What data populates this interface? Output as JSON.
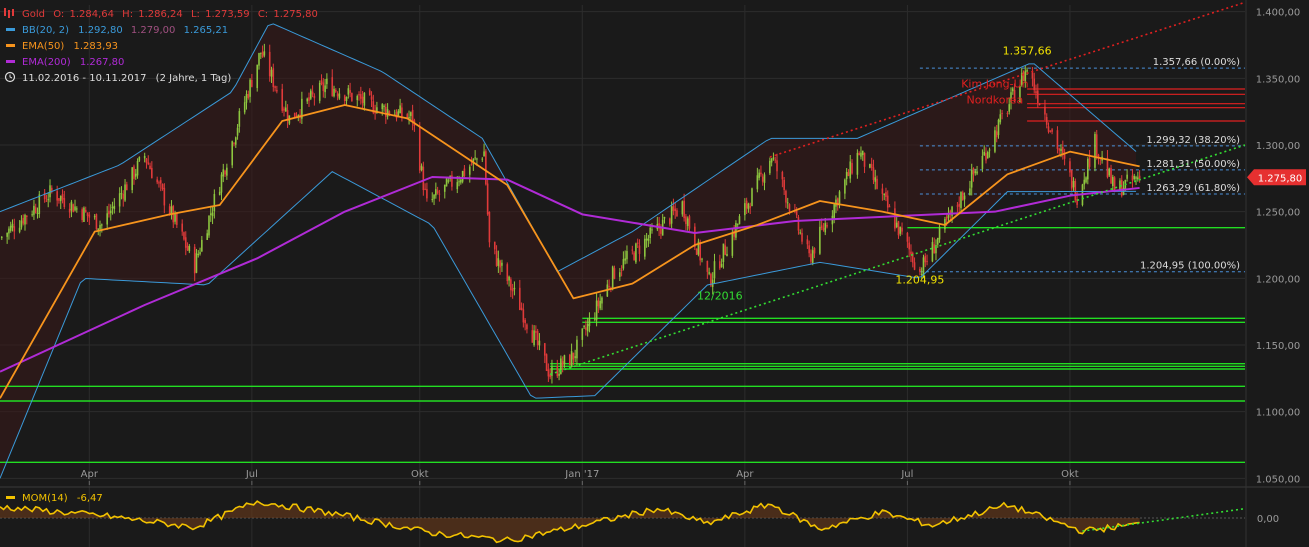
{
  "legend": {
    "symbol": "Gold",
    "open_label": "O:",
    "open": "1.284,64",
    "high_label": "H:",
    "high": "1.286,24",
    "low_label": "L:",
    "low": "1.273,59",
    "close_label": "C:",
    "close": "1.275,80",
    "bb_label": "BB(20, 2)",
    "bb_upper": "1.292,80",
    "bb_mid": "1.279,00",
    "bb_lower": "1.265,21",
    "ema50_label": "EMA(50)",
    "ema50": "1.283,93",
    "ema200_label": "EMA(200)",
    "ema200": "1.267,80",
    "range_text": "11.02.2016 - 10.11.2017",
    "period_text": "(2 Jahre, 1 Tag)"
  },
  "momentum": {
    "label": "MOM(14)",
    "value": "-6,47",
    "tick": "0,00"
  },
  "colors": {
    "background": "#1a1a1a",
    "bull_candle": "#8dc63f",
    "bear_candle": "#e03a3a",
    "bollinger": "#3a9ad9",
    "ema50": "#f7941d",
    "ema200": "#b02bd6",
    "support": "#22dd22",
    "resistance": "#e02020",
    "momentum": "#f2c200",
    "fib": "#4a90d9",
    "price_badge": "#e63030",
    "axis_text": "#9a9a9a"
  },
  "chart_data": {
    "type": "candlestick",
    "instrument": "Gold",
    "period": "11.02.2016 - 10.11.2017",
    "ylim": [
      1045,
      1405
    ],
    "yticks": [
      "1.050,00",
      "1.100,00",
      "1.150,00",
      "1.200,00",
      "1.250,00",
      "1.300,00",
      "1.350,00",
      "1.400,00"
    ],
    "ytick_values": [
      1050,
      1100,
      1150,
      1200,
      1250,
      1300,
      1350,
      1400
    ],
    "xticks": [
      {
        "label": "Apr",
        "date": "2016-04-01"
      },
      {
        "label": "Jul",
        "date": "2016-07-01"
      },
      {
        "label": "Okt",
        "date": "2016-10-03"
      },
      {
        "label": "Jan '17",
        "date": "2017-01-02"
      },
      {
        "label": "Apr",
        "date": "2017-04-03"
      },
      {
        "label": "Jul",
        "date": "2017-07-03"
      },
      {
        "label": "Okt",
        "date": "2017-10-02"
      }
    ],
    "price_path": [
      {
        "date": "2016-02-11",
        "close": 1230
      },
      {
        "date": "2016-03-11",
        "close": 1265
      },
      {
        "date": "2016-04-08",
        "close": 1240
      },
      {
        "date": "2016-05-02",
        "close": 1292
      },
      {
        "date": "2016-05-30",
        "close": 1210
      },
      {
        "date": "2016-06-24",
        "close": 1320
      },
      {
        "date": "2016-07-06",
        "close": 1370
      },
      {
        "date": "2016-07-22",
        "close": 1320
      },
      {
        "date": "2016-08-12",
        "close": 1345
      },
      {
        "date": "2016-09-06",
        "close": 1330
      },
      {
        "date": "2016-09-29",
        "close": 1320
      },
      {
        "date": "2016-10-07",
        "close": 1255
      },
      {
        "date": "2016-10-28",
        "close": 1280
      },
      {
        "date": "2016-11-08",
        "close": 1295
      },
      {
        "date": "2016-11-11",
        "close": 1225
      },
      {
        "date": "2016-11-28",
        "close": 1180
      },
      {
        "date": "2016-12-15",
        "close": 1128
      },
      {
        "date": "2016-12-28",
        "close": 1142
      },
      {
        "date": "2017-01-20",
        "close": 1205
      },
      {
        "date": "2017-02-27",
        "close": 1255
      },
      {
        "date": "2017-03-14",
        "close": 1198
      },
      {
        "date": "2017-04-18",
        "close": 1292
      },
      {
        "date": "2017-05-09",
        "close": 1215
      },
      {
        "date": "2017-06-06",
        "close": 1295
      },
      {
        "date": "2017-07-10",
        "close": 1205
      },
      {
        "date": "2017-08-14",
        "close": 1290
      },
      {
        "date": "2017-09-08",
        "close": 1357.66
      },
      {
        "date": "2017-10-06",
        "close": 1262
      },
      {
        "date": "2017-10-16",
        "close": 1302
      },
      {
        "date": "2017-10-27",
        "close": 1266
      },
      {
        "date": "2017-11-10",
        "close": 1275.8
      }
    ],
    "ema50_path": [
      {
        "date": "2016-02-11",
        "value": 1110
      },
      {
        "date": "2016-04-04",
        "value": 1235
      },
      {
        "date": "2016-05-16",
        "value": 1248
      },
      {
        "date": "2016-06-13",
        "value": 1255
      },
      {
        "date": "2016-07-18",
        "value": 1318
      },
      {
        "date": "2016-08-22",
        "value": 1330
      },
      {
        "date": "2016-09-26",
        "value": 1320
      },
      {
        "date": "2016-10-24",
        "value": 1295
      },
      {
        "date": "2016-11-21",
        "value": 1270
      },
      {
        "date": "2016-12-28",
        "value": 1185
      },
      {
        "date": "2017-01-30",
        "value": 1196
      },
      {
        "date": "2017-03-06",
        "value": 1225
      },
      {
        "date": "2017-04-10",
        "value": 1240
      },
      {
        "date": "2017-05-15",
        "value": 1258
      },
      {
        "date": "2017-06-19",
        "value": 1250
      },
      {
        "date": "2017-07-24",
        "value": 1240
      },
      {
        "date": "2017-08-28",
        "value": 1278
      },
      {
        "date": "2017-10-02",
        "value": 1295
      },
      {
        "date": "2017-11-10",
        "value": 1283.93
      }
    ],
    "ema200_path": [
      {
        "date": "2016-02-11",
        "value": 1130
      },
      {
        "date": "2016-05-02",
        "value": 1180
      },
      {
        "date": "2016-07-04",
        "value": 1215
      },
      {
        "date": "2016-08-22",
        "value": 1250
      },
      {
        "date": "2016-10-10",
        "value": 1276
      },
      {
        "date": "2016-11-21",
        "value": 1274
      },
      {
        "date": "2017-01-02",
        "value": 1248
      },
      {
        "date": "2017-03-06",
        "value": 1234
      },
      {
        "date": "2017-05-01",
        "value": 1243
      },
      {
        "date": "2017-07-03",
        "value": 1247
      },
      {
        "date": "2017-08-21",
        "value": 1250
      },
      {
        "date": "2017-10-02",
        "value": 1262
      },
      {
        "date": "2017-11-10",
        "value": 1267.8
      }
    ],
    "bollinger": {
      "upper": [
        {
          "date": "2016-02-11",
          "value": 1250
        },
        {
          "date": "2016-04-18",
          "value": 1285
        },
        {
          "date": "2016-06-20",
          "value": 1340
        },
        {
          "date": "2016-07-11",
          "value": 1392
        },
        {
          "date": "2016-09-12",
          "value": 1355
        },
        {
          "date": "2016-11-07",
          "value": 1305
        },
        {
          "date": "2016-12-19",
          "value": 1205
        },
        {
          "date": "2017-01-30",
          "value": 1235
        },
        {
          "date": "2017-04-17",
          "value": 1305
        },
        {
          "date": "2017-06-05",
          "value": 1305
        },
        {
          "date": "2017-09-11",
          "value": 1362
        },
        {
          "date": "2017-11-10",
          "value": 1292.8
        }
      ],
      "lower": [
        {
          "date": "2016-02-11",
          "value": 1050
        },
        {
          "date": "2016-03-28",
          "value": 1200
        },
        {
          "date": "2016-06-06",
          "value": 1195
        },
        {
          "date": "2016-08-15",
          "value": 1280
        },
        {
          "date": "2016-10-10",
          "value": 1240
        },
        {
          "date": "2016-12-05",
          "value": 1110
        },
        {
          "date": "2017-01-09",
          "value": 1112
        },
        {
          "date": "2017-03-13",
          "value": 1195
        },
        {
          "date": "2017-05-15",
          "value": 1212
        },
        {
          "date": "2017-07-10",
          "value": 1200
        },
        {
          "date": "2017-08-28",
          "value": 1265
        },
        {
          "date": "2017-11-10",
          "value": 1265.21
        }
      ]
    },
    "momentum_path": [
      {
        "date": "2016-02-11",
        "value": 12
      },
      {
        "date": "2016-04-11",
        "value": 2
      },
      {
        "date": "2016-05-30",
        "value": -10
      },
      {
        "date": "2016-07-04",
        "value": 18
      },
      {
        "date": "2016-08-15",
        "value": 5
      },
      {
        "date": "2016-10-10",
        "value": -16
      },
      {
        "date": "2016-11-21",
        "value": -24
      },
      {
        "date": "2017-01-02",
        "value": -8
      },
      {
        "date": "2017-02-13",
        "value": 10
      },
      {
        "date": "2017-03-13",
        "value": -6
      },
      {
        "date": "2017-04-17",
        "value": 15
      },
      {
        "date": "2017-05-15",
        "value": -12
      },
      {
        "date": "2017-06-19",
        "value": 6
      },
      {
        "date": "2017-07-17",
        "value": -8
      },
      {
        "date": "2017-08-28",
        "value": 14
      },
      {
        "date": "2017-10-09",
        "value": -14
      },
      {
        "date": "2017-11-10",
        "value": -6.47
      }
    ],
    "momentum_ylim": [
      -30,
      30
    ],
    "fibonacci": [
      {
        "label": "1.357,66 (0.00%)",
        "value": 1357.66
      },
      {
        "label": "1.299,32 (38.20%)",
        "value": 1299.32
      },
      {
        "label": "1.281,31 (50.00%)",
        "value": 1281.31
      },
      {
        "label": "1.263,29 (61.80%)",
        "value": 1263.29
      },
      {
        "label": "1.204,95 (100.00%)",
        "value": 1204.95
      }
    ],
    "fib_start_date": "2017-07-10",
    "support_lines": [
      {
        "value": 1238,
        "from": "2017-07-03"
      },
      {
        "value": 1170,
        "from": "2017-01-02"
      },
      {
        "value": 1167,
        "from": "2017-01-02"
      },
      {
        "value": 1136,
        "from": "2016-12-15"
      },
      {
        "value": 1134,
        "from": "2016-12-15"
      },
      {
        "value": 1132,
        "from": "2016-12-15"
      },
      {
        "value": 1119,
        "from": "2016-02-11"
      },
      {
        "value": 1108,
        "from": "2016-02-11"
      },
      {
        "value": 1062,
        "from": "2016-02-11"
      }
    ],
    "resistance_lines": [
      {
        "value": 1342,
        "from": "2017-09-08"
      },
      {
        "value": 1338,
        "from": "2017-09-08"
      },
      {
        "value": 1331,
        "from": "2017-09-08"
      },
      {
        "value": 1328,
        "from": "2017-09-08"
      },
      {
        "value": 1318,
        "from": "2017-09-08"
      }
    ],
    "trendlines": [
      {
        "color": "red",
        "style": "dotted",
        "from": {
          "date": "2017-04-17",
          "value": 1291
        },
        "to": {
          "date": "2018-01-08",
          "value": 1407
        }
      },
      {
        "color": "green",
        "style": "dotted",
        "from": {
          "date": "2016-12-15",
          "value": 1128
        },
        "to": {
          "date": "2018-01-08",
          "value": 1300
        }
      }
    ],
    "momentum_trendline": {
      "from": {
        "date": "2017-10-09",
        "value": -14
      },
      "to": {
        "date": "2018-01-08",
        "value": 10
      }
    },
    "annotations": [
      {
        "text": "1.357,66",
        "date": "2017-09-08",
        "value": 1368
      },
      {
        "text": "1.204,95",
        "date": "2017-07-10",
        "value": 1196
      },
      {
        "text": "12/2016",
        "date": "2017-03-20",
        "value": 1184
      },
      {
        "text": "Kim Jong-Un",
        "date": "2017-08-21",
        "value": 1343
      },
      {
        "text": "Nordkorea",
        "date": "2017-08-21",
        "value": 1331
      }
    ],
    "last_price": {
      "label": "1.275,80",
      "value": 1275.8
    }
  }
}
